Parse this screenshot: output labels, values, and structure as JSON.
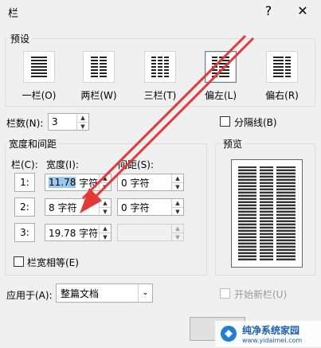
{
  "window": {
    "title": "栏",
    "help_label": "?",
    "close_label": "✕"
  },
  "presets": {
    "label": "预设",
    "items": [
      {
        "label": "一栏(O)",
        "columns": 1,
        "selected": false
      },
      {
        "label": "两栏(W)",
        "columns": 2,
        "selected": false
      },
      {
        "label": "三栏(T)",
        "columns": 3,
        "selected": false
      },
      {
        "label": "偏左(L)",
        "columns": "left",
        "selected": true
      },
      {
        "label": "偏右(R)",
        "columns": "right",
        "selected": false
      }
    ]
  },
  "column_count": {
    "label": "栏数(N):",
    "value": "3"
  },
  "separator": {
    "label": "分隔线(B)",
    "checked": false
  },
  "width_spacing": {
    "label": "宽度和间距",
    "col_header": "栏(C):",
    "width_header": "宽度(I):",
    "spacing_header": "间距(S):",
    "rows": [
      {
        "num": "1:",
        "width": "11.78 字符",
        "width_number": "11.78",
        "width_unit": "字符",
        "spacing": "0 字符"
      },
      {
        "num": "2:",
        "width": "8 字符",
        "spacing": "0 字符"
      },
      {
        "num": "3:",
        "width": "19.78 字符",
        "spacing": ""
      }
    ]
  },
  "equal_width": {
    "label": "栏宽相等(E)",
    "checked": false
  },
  "preview": {
    "label": "预览"
  },
  "apply_to": {
    "label": "应用于(A):",
    "value": "整篇文档"
  },
  "start_new_column": {
    "label": "开始新栏(U)",
    "checked": false
  },
  "watermark": {
    "text": "纯净系统家园",
    "url": "www.yidaimei.com"
  },
  "colors": {
    "arrow": "#e53935",
    "selection": "#99c9ef"
  }
}
